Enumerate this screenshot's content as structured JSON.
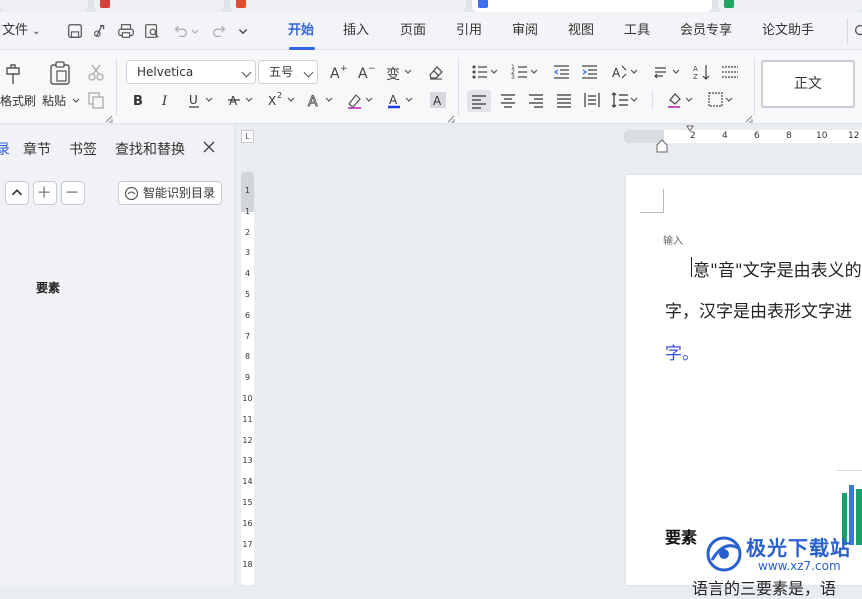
{
  "menu": {
    "file": "文件",
    "items": [
      "开始",
      "插入",
      "页面",
      "引用",
      "审阅",
      "视图",
      "工具",
      "会员专享",
      "论文助手"
    ],
    "active": "开始"
  },
  "ribbon": {
    "format_painter": "格式刷",
    "paste": "粘贴",
    "font_name": "Helvetica",
    "font_size": "五号",
    "style_normal": "正文"
  },
  "nav": {
    "tab_contents_partial": "录",
    "tab_sections": "章节",
    "tab_bookmarks": "书签",
    "tab_find_replace": "查找和替换",
    "smart_toc_button": "智能识别目录",
    "toc_item": "要素"
  },
  "ruler": {
    "horizontal": [
      "2",
      "4",
      "6",
      "8",
      "10",
      "12"
    ],
    "vertical": [
      "1",
      "1",
      "2",
      "3",
      "4",
      "5",
      "6",
      "7",
      "8",
      "9",
      "10",
      "11",
      "12",
      "13",
      "14",
      "15",
      "16",
      "17",
      "18"
    ]
  },
  "document": {
    "small_label": "输入",
    "line1": "意\"音\"文字是由表义的",
    "line2": "字，汉字是由表形文字进",
    "line3": "字。",
    "heading": "要素",
    "cut_line": "语言的三要素是，语"
  },
  "watermark": {
    "title": "极光下载站",
    "url": "www.xz7.com"
  },
  "colors": {
    "accent": "#3366e6",
    "ribbon_bg": "#f7f8fa",
    "panel_bg": "#f1f2f5",
    "canvas_bg": "#e9ecf1",
    "link_text": "#3a4fd8"
  }
}
